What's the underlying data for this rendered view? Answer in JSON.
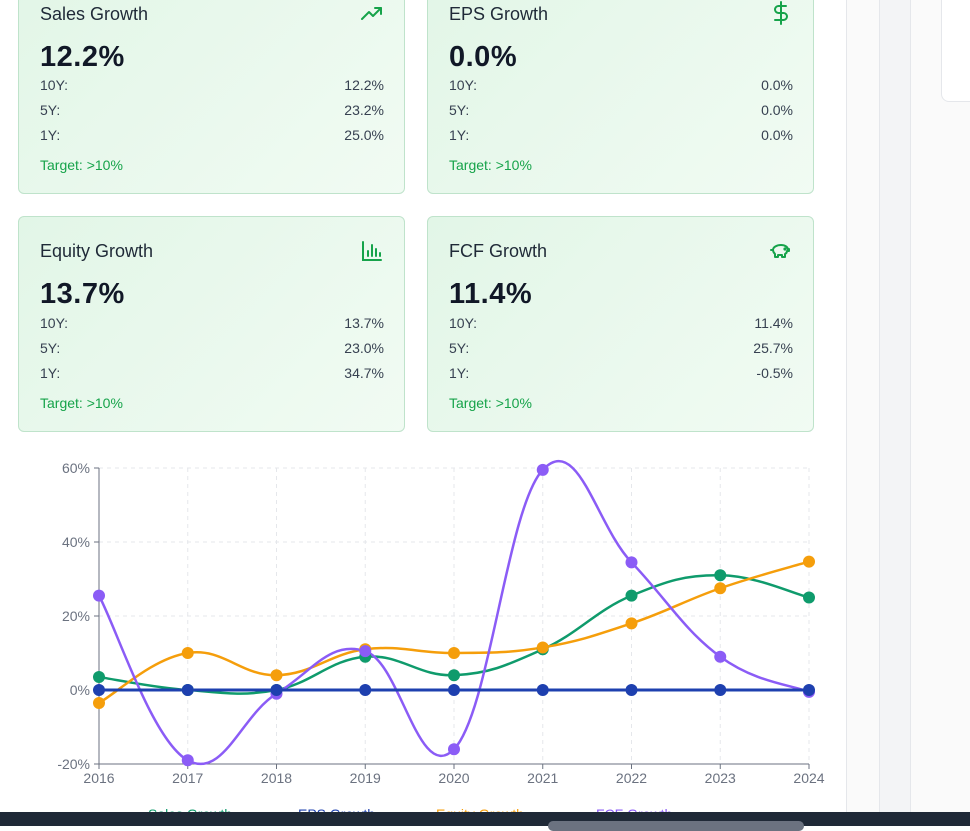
{
  "cards": [
    {
      "title": "Sales Growth",
      "value": "12.2%",
      "icon": "trending-up-icon",
      "rows": [
        {
          "k": "10Y:",
          "v": "12.2%"
        },
        {
          "k": "5Y:",
          "v": "23.2%"
        },
        {
          "k": "1Y:",
          "v": "25.0%"
        }
      ],
      "target": "Target: >10%"
    },
    {
      "title": "EPS Growth",
      "value": "0.0%",
      "icon": "dollar-icon",
      "rows": [
        {
          "k": "10Y:",
          "v": "0.0%"
        },
        {
          "k": "5Y:",
          "v": "0.0%"
        },
        {
          "k": "1Y:",
          "v": "0.0%"
        }
      ],
      "target": "Target: >10%"
    },
    {
      "title": "Equity Growth",
      "value": "13.7%",
      "icon": "bar-chart-icon",
      "rows": [
        {
          "k": "10Y:",
          "v": "13.7%"
        },
        {
          "k": "5Y:",
          "v": "23.0%"
        },
        {
          "k": "1Y:",
          "v": "34.7%"
        }
      ],
      "target": "Target: >10%"
    },
    {
      "title": "FCF Growth",
      "value": "11.4%",
      "icon": "piggy-bank-icon",
      "rows": [
        {
          "k": "10Y:",
          "v": "11.4%"
        },
        {
          "k": "5Y:",
          "v": "25.7%"
        },
        {
          "k": "1Y:",
          "v": "-0.5%"
        }
      ],
      "target": "Target: >10%"
    }
  ],
  "colors": {
    "accent": "#16a34a",
    "sales": "#0f9b6c",
    "eps": "#1e40af",
    "equity": "#f59e0b",
    "fcf": "#8b5cf6"
  },
  "chart_data": {
    "type": "line",
    "categories": [
      "2016",
      "2017",
      "2018",
      "2019",
      "2020",
      "2021",
      "2022",
      "2023",
      "2024"
    ],
    "ylim": [
      -20,
      60
    ],
    "yticks": [
      "-20%",
      "0%",
      "20%",
      "40%",
      "60%"
    ],
    "grid": true,
    "legend": "bottom",
    "series": [
      {
        "name": "Sales Growth",
        "color": "#0f9b6c",
        "values": [
          3.5,
          0,
          0,
          9,
          4,
          11,
          25.5,
          31,
          25
        ]
      },
      {
        "name": "EPS Growth",
        "color": "#1e40af",
        "values": [
          0,
          0,
          0,
          0,
          0,
          0,
          0,
          0,
          0
        ]
      },
      {
        "name": "Equity Growth",
        "color": "#f59e0b",
        "values": [
          -3.5,
          10,
          4,
          11,
          10,
          11.5,
          18,
          27.5,
          34.7
        ]
      },
      {
        "name": "FCF Growth",
        "color": "#8b5cf6",
        "values": [
          25.5,
          -19,
          -1,
          10.5,
          -16,
          59.5,
          34.5,
          9,
          -0.5
        ]
      }
    ]
  }
}
